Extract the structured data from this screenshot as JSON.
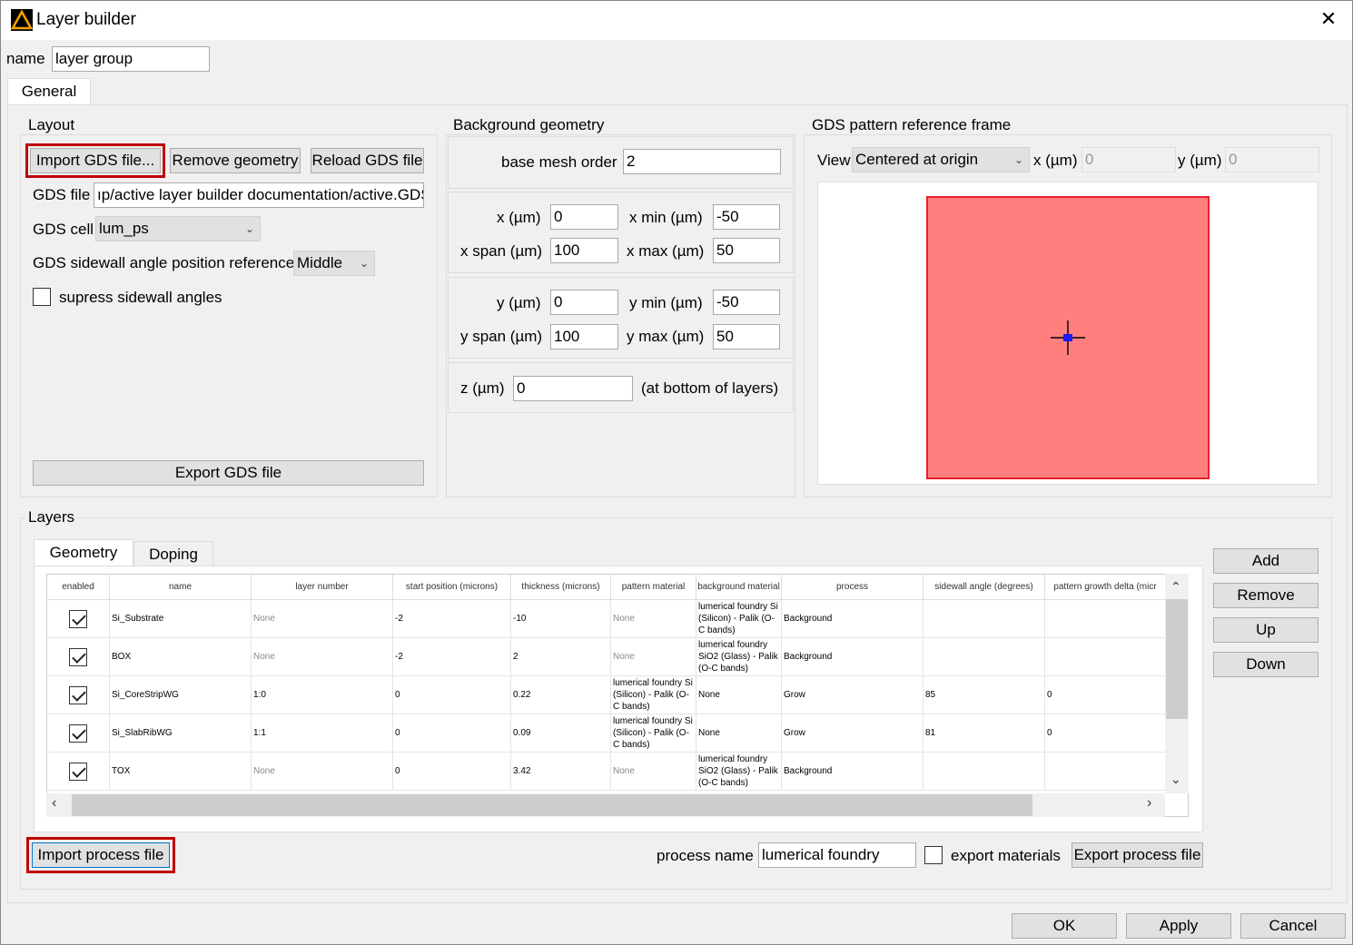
{
  "window": {
    "title": "Layer builder",
    "close": "✕"
  },
  "name_label": "name",
  "name_value": "layer group",
  "tabs": {
    "general": "General"
  },
  "layout": {
    "title": "Layout",
    "import_gds": "Import GDS file...",
    "remove_geometry": "Remove geometry",
    "reload_gds": "Reload GDS file",
    "gds_file_label": "GDS file",
    "gds_file_value": "ıp/active layer builder documentation/active.GDS",
    "gds_cell_label": "GDS cell",
    "gds_cell_value": "lum_ps",
    "sidewall_ref_label": "GDS sidewall angle position reference",
    "sidewall_ref_value": "Middle",
    "supress_label": "supress sidewall angles",
    "export_gds": "Export GDS file"
  },
  "background": {
    "title": "Background geometry",
    "mesh_label": "base mesh order",
    "mesh_value": "2",
    "x_label": "x (µm)",
    "x_value": "0",
    "xmin_label": "x min (µm)",
    "xmin_value": "-50",
    "xspan_label": "x span (µm)",
    "xspan_value": "100",
    "xmax_label": "x max (µm)",
    "xmax_value": "50",
    "y_label": "y (µm)",
    "y_value": "0",
    "ymin_label": "y min (µm)",
    "ymin_value": "-50",
    "yspan_label": "y span (µm)",
    "yspan_value": "100",
    "ymax_label": "y max (µm)",
    "ymax_value": "50",
    "z_label": "z (µm)",
    "z_value": "0",
    "z_note": "(at bottom of layers)"
  },
  "gds_frame": {
    "title": "GDS pattern reference frame",
    "view_label": "View",
    "view_value": "Centered at origin",
    "x_label": "x (µm)",
    "x_value": "0",
    "y_label": "y (µm)",
    "y_value": "0",
    "colors": {
      "pattern_fill": "#ff7f7f",
      "pattern_stroke": "#e8202a",
      "marker": "#1a1aff"
    }
  },
  "layers": {
    "title": "Layers",
    "tab_geometry": "Geometry",
    "tab_doping": "Doping",
    "columns": [
      "enabled",
      "name",
      "layer number",
      "start position (microns)",
      "thickness (microns)",
      "pattern material",
      "background material",
      "process",
      "sidewall angle (degrees)",
      "pattern growth delta (micr"
    ],
    "rows": [
      {
        "name": "Si_Substrate",
        "layer": "None",
        "start": "-2",
        "thickness": "-10",
        "pattern": "None",
        "background": "lumerical foundry Si (Silicon) - Palik (O-C bands)",
        "process": "Background",
        "sidewall": "",
        "growth": ""
      },
      {
        "name": "BOX",
        "layer": "None",
        "start": "-2",
        "thickness": "2",
        "pattern": "None",
        "background": "lumerical foundry SiO2 (Glass) - Palik (O-C bands)",
        "process": "Background",
        "sidewall": "",
        "growth": ""
      },
      {
        "name": "Si_CoreStripWG",
        "layer": "1:0",
        "start": "0",
        "thickness": "0.22",
        "pattern": "lumerical foundry Si (Silicon) - Palik (O-C bands)",
        "background": "None",
        "process": "Grow",
        "sidewall": "85",
        "growth": "0"
      },
      {
        "name": "Si_SlabRibWG",
        "layer": "1:1",
        "start": "0",
        "thickness": "0.09",
        "pattern": "lumerical foundry Si (Silicon) - Palik (O-C bands)",
        "background": "None",
        "process": "Grow",
        "sidewall": "81",
        "growth": "0"
      },
      {
        "name": "TOX",
        "layer": "None",
        "start": "0",
        "thickness": "3.42",
        "pattern": "None",
        "background": "lumerical foundry SiO2 (Glass) - Palik (O-C bands)",
        "process": "Background",
        "sidewall": "",
        "growth": ""
      }
    ],
    "add": "Add",
    "remove": "Remove",
    "up": "Up",
    "down": "Down",
    "import_process": "Import process file",
    "process_name_label": "process name",
    "process_name_value": "lumerical foundry",
    "export_materials_label": "export materials",
    "export_process": "Export process file"
  },
  "footer": {
    "ok": "OK",
    "apply": "Apply",
    "cancel": "Cancel"
  }
}
